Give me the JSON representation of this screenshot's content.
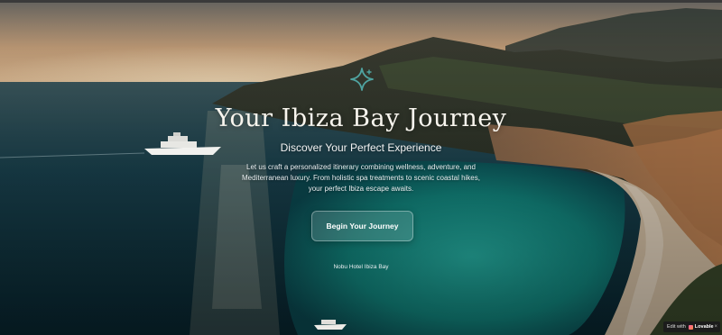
{
  "hero": {
    "title": "Your Ibiza Bay Journey",
    "subtitle": "Discover Your Perfect Experience",
    "description": "Let us craft a personalized itinerary combining wellness, adventure, and Mediterranean luxury. From holistic spa treatments to scenic coastal hikes, your perfect Ibiza escape awaits.",
    "cta_label": "Begin Your Journey",
    "hotel_name": "Nobu Hotel Ibiza Bay"
  },
  "badge": {
    "prefix": "Edit with",
    "brand": "Lovable",
    "close": "×"
  },
  "icons": {
    "hero": "sparkle-icon",
    "badge": "lovable-heart-icon",
    "close": "close-icon"
  },
  "colors": {
    "sparkle": "#4fa3a0",
    "sea_deep": "#0c3440",
    "lagoon": "#1fa39a",
    "cliff": "#c98a57",
    "sky_warm": "#e9b98a"
  }
}
